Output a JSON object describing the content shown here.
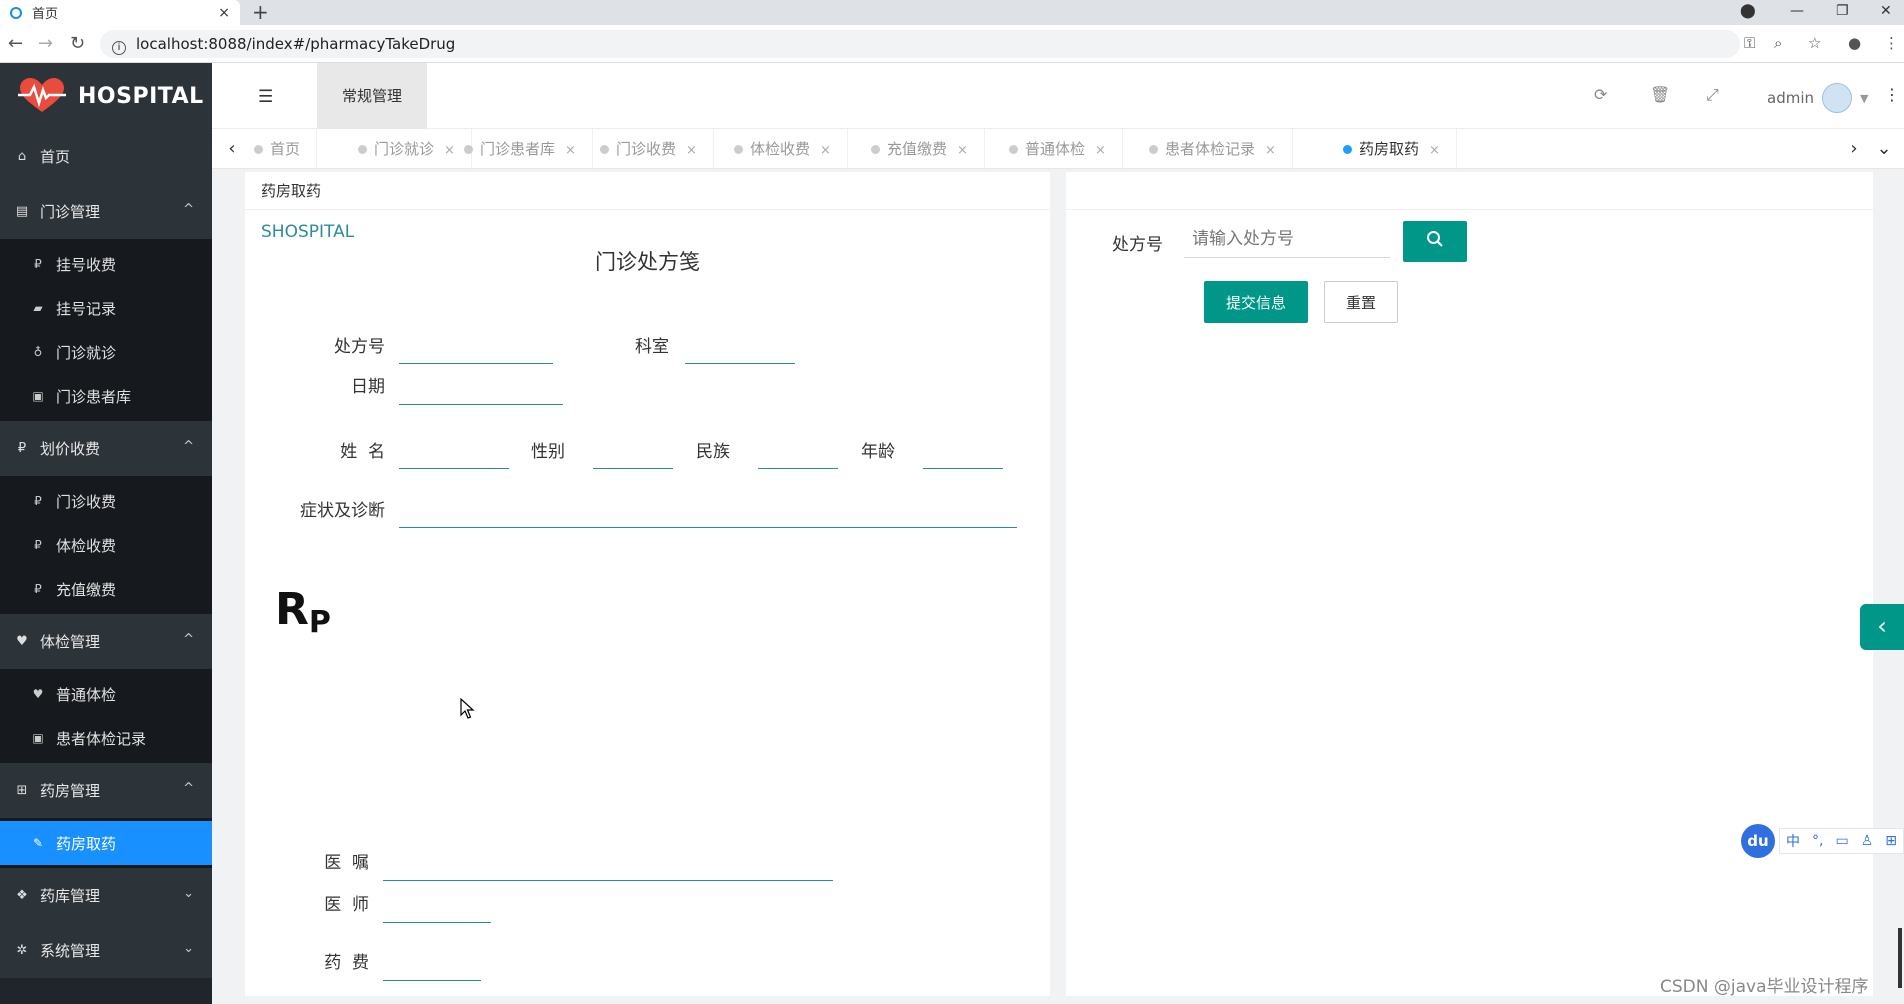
{
  "browser": {
    "tab_title": "首页",
    "tab_close": "×",
    "new_tab": "+",
    "url": "localhost:8088/index#/pharmacyTakeDrug",
    "info_glyph": "i"
  },
  "sidebar": {
    "logo_text": "HOSPITAL",
    "home_label": "首页",
    "groups": [
      {
        "label": "门诊管理",
        "caret": "^",
        "items": [
          "挂号收费",
          "挂号记录",
          "门诊就诊",
          "门诊患者库"
        ]
      },
      {
        "label": "划价收费",
        "caret": "^",
        "items": [
          "门诊收费",
          "体检收费",
          "充值缴费"
        ]
      },
      {
        "label": "体检管理",
        "caret": "^",
        "items": [
          "普通体检",
          "患者体检记录"
        ]
      },
      {
        "label": "药房管理",
        "caret": "^",
        "items": [
          "药房取药"
        ]
      },
      {
        "label": "药库管理",
        "caret": "⌄"
      },
      {
        "label": "系统管理",
        "caret": "⌄"
      }
    ]
  },
  "header": {
    "module_tab": "常规管理",
    "username": "admin"
  },
  "page_tabs": [
    {
      "label": "首页",
      "active": false
    },
    {
      "label": "门诊就诊",
      "active": false
    },
    {
      "label": "门诊患者库",
      "active": false
    },
    {
      "label": "门诊收费",
      "active": false
    },
    {
      "label": "体检收费",
      "active": false
    },
    {
      "label": "充值缴费",
      "active": false
    },
    {
      "label": "普通体检",
      "active": false
    },
    {
      "label": "患者体检记录",
      "active": false
    },
    {
      "label": "药房取药",
      "active": true
    }
  ],
  "prescription": {
    "card_title": "药房取药",
    "brand": "SHOSPITAL",
    "title": "门诊处方笺",
    "labels": {
      "rx_no": "处方号",
      "dept": "科室",
      "date": "日期",
      "name": "姓  名",
      "gender": "性别",
      "ethnicity": "民族",
      "age": "年龄",
      "diagnosis": "症状及诊断",
      "advice": "医  嘱",
      "doctor": "医  师",
      "fee": "药  费"
    },
    "rp_main": "R",
    "rp_sub": "P"
  },
  "search_form": {
    "label": "处方号",
    "placeholder": "请输入处方号",
    "submit_label": "提交信息",
    "reset_label": "重置"
  },
  "ime": {
    "du": "du",
    "lang": "中"
  },
  "watermark": "CSDN @java毕业设计程序",
  "colors": {
    "primary": "#009688",
    "active_nav": "#1890ff",
    "sidebar_bg": "#1f252b",
    "form_line": "#2d8c9c"
  }
}
